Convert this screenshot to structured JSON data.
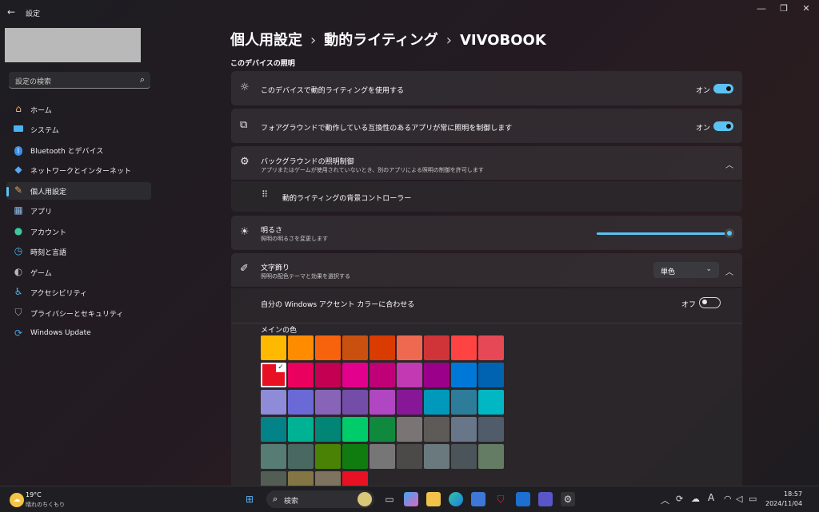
{
  "window": {
    "title": "設定",
    "back_icon": "back-arrow-icon",
    "controls": [
      "―",
      "❐",
      "✕"
    ]
  },
  "sidebar": {
    "search_placeholder": "設定の検索",
    "items": [
      {
        "label": "ホーム",
        "icon": "home-icon",
        "color": "#f0b27a"
      },
      {
        "label": "システム",
        "icon": "system-icon",
        "color": "#4ab3f4"
      },
      {
        "label": "Bluetooth とデバイス",
        "icon": "bluetooth-icon",
        "color": "#3b8ee8"
      },
      {
        "label": "ネットワークとインターネット",
        "icon": "network-icon",
        "color": "#56a9f5"
      },
      {
        "label": "個人用設定",
        "icon": "personalize-icon",
        "color": "#e8a05c",
        "active": true
      },
      {
        "label": "アプリ",
        "icon": "apps-icon",
        "color": "#8fb9e0"
      },
      {
        "label": "アカウント",
        "icon": "account-icon",
        "color": "#3ec89a"
      },
      {
        "label": "時刻と言語",
        "icon": "time-language-icon",
        "color": "#58b6ef"
      },
      {
        "label": "ゲーム",
        "icon": "gaming-icon",
        "color": "#b7b7b7"
      },
      {
        "label": "アクセシビリティ",
        "icon": "accessibility-icon",
        "color": "#52b6f0"
      },
      {
        "label": "プライバシーとセキュリティ",
        "icon": "shield-icon",
        "color": "#9aa7b3"
      },
      {
        "label": "Windows Update",
        "icon": "windows-update-icon",
        "color": "#3ea3ef"
      }
    ]
  },
  "breadcrumb": [
    "個人用設定",
    "動的ライティング",
    "VIVOBOOK"
  ],
  "breadcrumb_separator": "›",
  "section_title": "このデバイスの照明",
  "cards": {
    "use_dynamic": {
      "title": "このデバイスで動的ライティングを使用する",
      "state": "オン"
    },
    "foreground": {
      "title": "フォアグラウンドで動作している互換性のあるアプリが常に照明を制御します",
      "state": "オン"
    },
    "background": {
      "title": "バックグラウンドの照明制御",
      "subtitle": "アプリまたはゲームが使用されていないとき、別のアプリによる照明の制御を許可します",
      "controller": "動的ライティングの背景コントローラー"
    },
    "brightness": {
      "title": "明るさ",
      "subtitle": "照明の明るさを変更します",
      "value": 1.0
    },
    "effects": {
      "title": "文字飾り",
      "subtitle": "照明の配色テーマと効果を選択する",
      "selected": "単色",
      "accent_label": "自分の Windows アクセント カラーに合わせる",
      "accent_state": "オフ",
      "main_color_label": "メインの色"
    }
  },
  "palette": [
    [
      "#FFB900",
      "#FF8C00",
      "#F7630C",
      "#CA5010",
      "#DA3B01",
      "#EF6950",
      "#D13438",
      "#FF4343",
      "#E74856"
    ],
    [
      "#E81123",
      "#EA005E",
      "#C30052",
      "#E3008C",
      "#BF0077",
      "#C239B3",
      "#9A0089",
      "#0078D7",
      "#0063B1"
    ],
    [
      "#8E8CD8",
      "#6B69D6",
      "#8764B8",
      "#744DA9",
      "#B146C2",
      "#881798",
      "#0099BC",
      "#2D7D9A",
      "#00B7C3"
    ],
    [
      "#038387",
      "#00B294",
      "#018574",
      "#00CC6A",
      "#10893E",
      "#7A7574",
      "#5D5A58",
      "#68768A",
      "#515C6B"
    ],
    [
      "#567C73",
      "#486860",
      "#498205",
      "#107C10",
      "#767676",
      "#4C4A48",
      "#69797E",
      "#4A5459",
      "#647C64"
    ],
    [
      "#525E54",
      "#847545",
      "#7E735F",
      "#E81123"
    ]
  ],
  "selected_swatch": "#E81123",
  "taskbar": {
    "weather_temp": "19°C",
    "weather_desc": "晴れのちくもり",
    "search_label": "検索",
    "time": "18:57",
    "date": "2024/11/04",
    "ime": "A"
  }
}
